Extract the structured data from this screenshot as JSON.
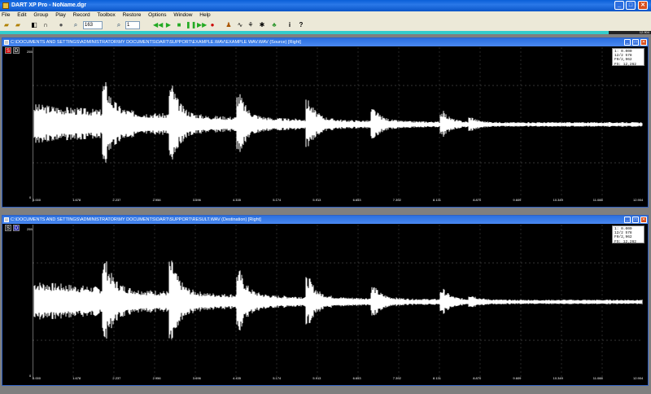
{
  "app": {
    "title": "DART XP Pro - NoName.dgr"
  },
  "menu": [
    "File",
    "Edit",
    "Group",
    "Play",
    "Record",
    "Toolbox",
    "Restore",
    "Options",
    "Window",
    "Help"
  ],
  "toolbar": {
    "zoom_value": "163",
    "channel_value": "1"
  },
  "progress": {
    "time": "12.904",
    "fraction": 0.935
  },
  "windows": [
    {
      "title": "C:\\DOCUMENTS AND SETTINGS\\ADMINISTRATOR\\MY DOCUMENTS\\DART\\SUPPORT\\EXAMPLE.WAV\\EXAMPLE WAV.WAV (Source) [Right]",
      "s_label": "S",
      "d_label": "D",
      "active": "S",
      "y_top": "255",
      "y_bottom": "0",
      "info": [
        "1:  0.000",
        "12/2 578",
        "F0/2,962",
        "FS: 12,262"
      ]
    },
    {
      "title": "C:\\DOCUMENTS AND SETTINGS\\ADMINISTRATOR\\MY DOCUMENTS\\DART\\SUPPORT\\RESULT.WAV (Destination) [Right]",
      "s_label": "S",
      "d_label": "D",
      "active": "D",
      "y_top": "255",
      "y_bottom": "0",
      "info": [
        "1:  0.000",
        "12/2 578",
        "F0/2,962",
        "FS: 12,262"
      ]
    }
  ],
  "x_ticks": [
    "0.000",
    "1.678",
    "2.237",
    "2.956",
    "3.696",
    "4.435",
    "5.174",
    "5.913",
    "6.653",
    "7.392",
    "8.131",
    "8.870",
    "9.609",
    "10.349",
    "11.088",
    "12.904"
  ]
}
